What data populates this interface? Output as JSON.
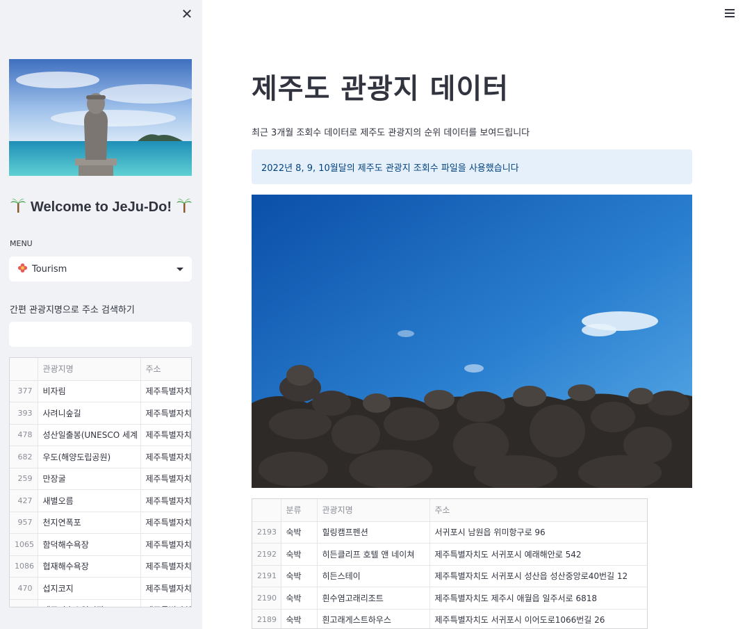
{
  "sidebar": {
    "close_icon": "close-icon",
    "welcome_text": "Welcome to JeJu-Do!",
    "welcome_emoji": "palm-tree-icon",
    "menu_label": "MENU",
    "menu_selected": "Tourism",
    "menu_selected_icon": "flower-icon",
    "search_label": "간편 관광지명으로 주소 검색하기",
    "search_value": "",
    "search_placeholder": "",
    "table": {
      "headers": [
        "",
        "관광지명",
        "주소"
      ],
      "rows": [
        [
          "377",
          "비자림",
          "제주특별자치도"
        ],
        [
          "393",
          "사려니숲길",
          "제주특별자치도"
        ],
        [
          "478",
          "성산일출봉(UNESCO 세계",
          "제주특별자치도"
        ],
        [
          "682",
          "우도(해양도립공원)",
          "제주특별자치도"
        ],
        [
          "259",
          "만장굴",
          "제주특별자치도"
        ],
        [
          "427",
          "새별오름",
          "제주특별자치도"
        ],
        [
          "957",
          "천지연폭포",
          "제주특별자치도"
        ],
        [
          "1065",
          "함덕해수욕장",
          "제주특별자치도"
        ],
        [
          "1086",
          "협재해수욕장",
          "제주특별자치도"
        ],
        [
          "470",
          "섭지코지",
          "제주특별자치도"
        ],
        [
          "",
          "제주민속오일시장",
          "제주특별자치도"
        ]
      ]
    }
  },
  "main": {
    "menu_icon": "hamburger-icon",
    "title": "제주도 관광지 데이터",
    "subtitle": "최근 3개월 조회수 데이터로 제주도 관광지의 순위 데이터를 보여드립니다",
    "info": "2022년 8, 9, 10월달의 제주도 관광지 조회수 파일을 사용했습니다",
    "table": {
      "headers": [
        "",
        "분류",
        "관광지명",
        "주소"
      ],
      "rows": [
        [
          "2193",
          "숙박",
          "힐링캠프펜션",
          "서귀포시 남원읍 위미항구로 96"
        ],
        [
          "2192",
          "숙박",
          "히든클리프 호텔 앤 네이쳐",
          "제주특별자치도 서귀포시 예래해안로 542"
        ],
        [
          "2191",
          "숙박",
          "히든스테이",
          "제주특별자치도 서귀포시 성산읍 성산중앙로40번길 12"
        ],
        [
          "2190",
          "숙박",
          "흰수염고래리조트",
          "제주특별자치도 제주시 애월읍 일주서로 6818"
        ],
        [
          "2189",
          "숙박",
          "흰고래게스트하우스",
          "제주특별자치도 서귀포시 이어도로1066번길 26"
        ]
      ]
    }
  },
  "colors": {
    "sidebar_bg": "#f0f2f6",
    "text": "#31333f",
    "info_bg": "#e6f0fb",
    "info_text": "#004280"
  }
}
